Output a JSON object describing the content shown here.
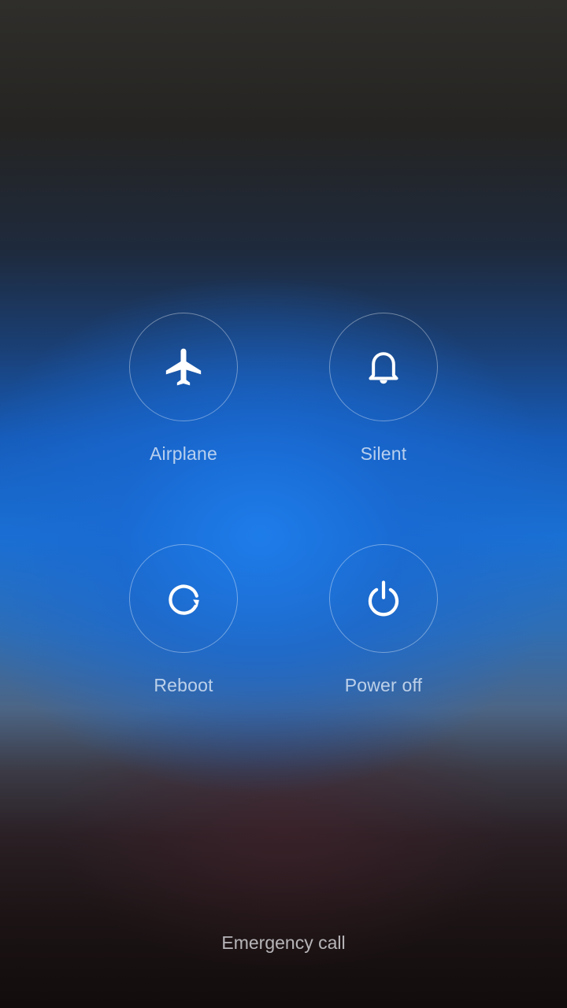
{
  "power_menu": {
    "actions": [
      {
        "id": "airplane",
        "label": "Airplane",
        "icon": "airplane-icon"
      },
      {
        "id": "silent",
        "label": "Silent",
        "icon": "bell-icon"
      },
      {
        "id": "reboot",
        "label": "Reboot",
        "icon": "reboot-icon"
      },
      {
        "id": "power_off",
        "label": "Power off",
        "icon": "power-icon"
      }
    ],
    "emergency_call_label": "Emergency call"
  },
  "colors": {
    "accent_blue": "#1a70d4",
    "icon_white": "#ffffff",
    "label_text": "#dce6f5"
  }
}
